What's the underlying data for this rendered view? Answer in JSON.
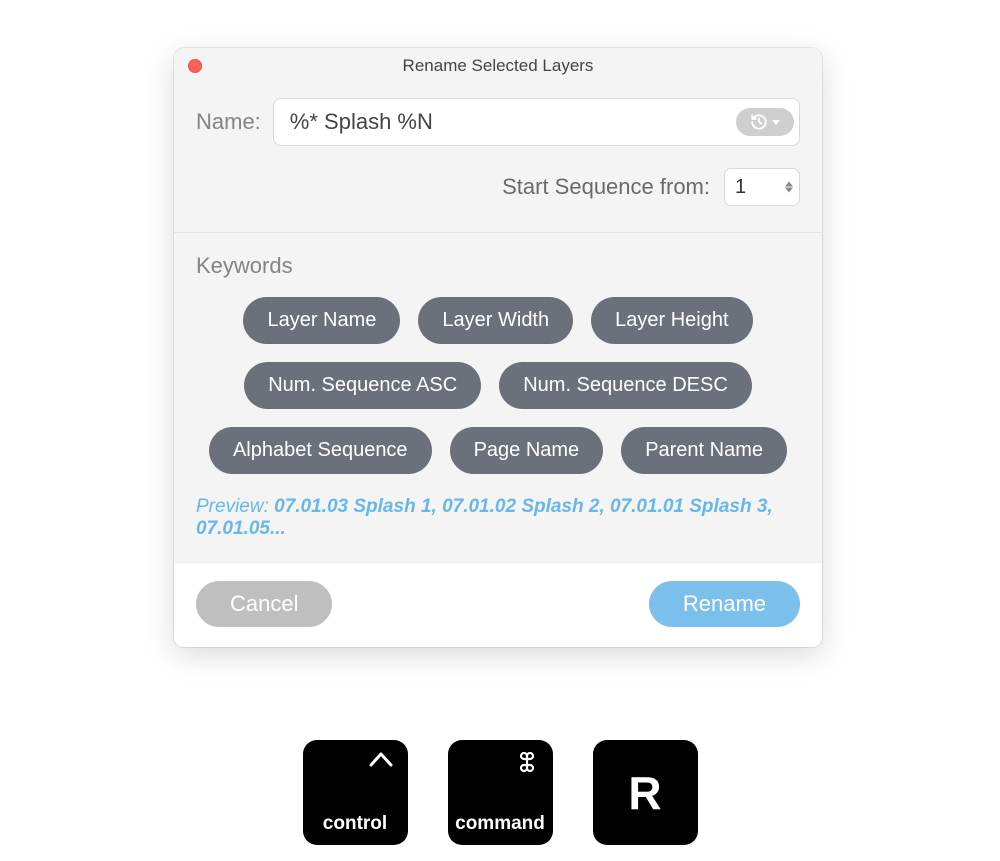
{
  "window": {
    "title": "Rename Selected Layers"
  },
  "name": {
    "label": "Name:",
    "value": "%* Splash %N"
  },
  "sequence": {
    "label": "Start Sequence from:",
    "value": "1"
  },
  "keywords": {
    "heading": "Keywords",
    "rows": [
      [
        "Layer Name",
        "Layer Width",
        "Layer Height"
      ],
      [
        "Num. Sequence ASC",
        "Num. Sequence DESC"
      ],
      [
        "Alphabet Sequence",
        "Page Name",
        "Parent Name"
      ]
    ]
  },
  "preview": {
    "label": "Preview: ",
    "text": "07.01.03 Splash 1, 07.01.02 Splash 2, 07.01.01 Splash 3, 07.01.05..."
  },
  "footer": {
    "cancel": "Cancel",
    "rename": "Rename"
  },
  "shortcut": {
    "control": "control",
    "command": "command",
    "key": "R"
  }
}
